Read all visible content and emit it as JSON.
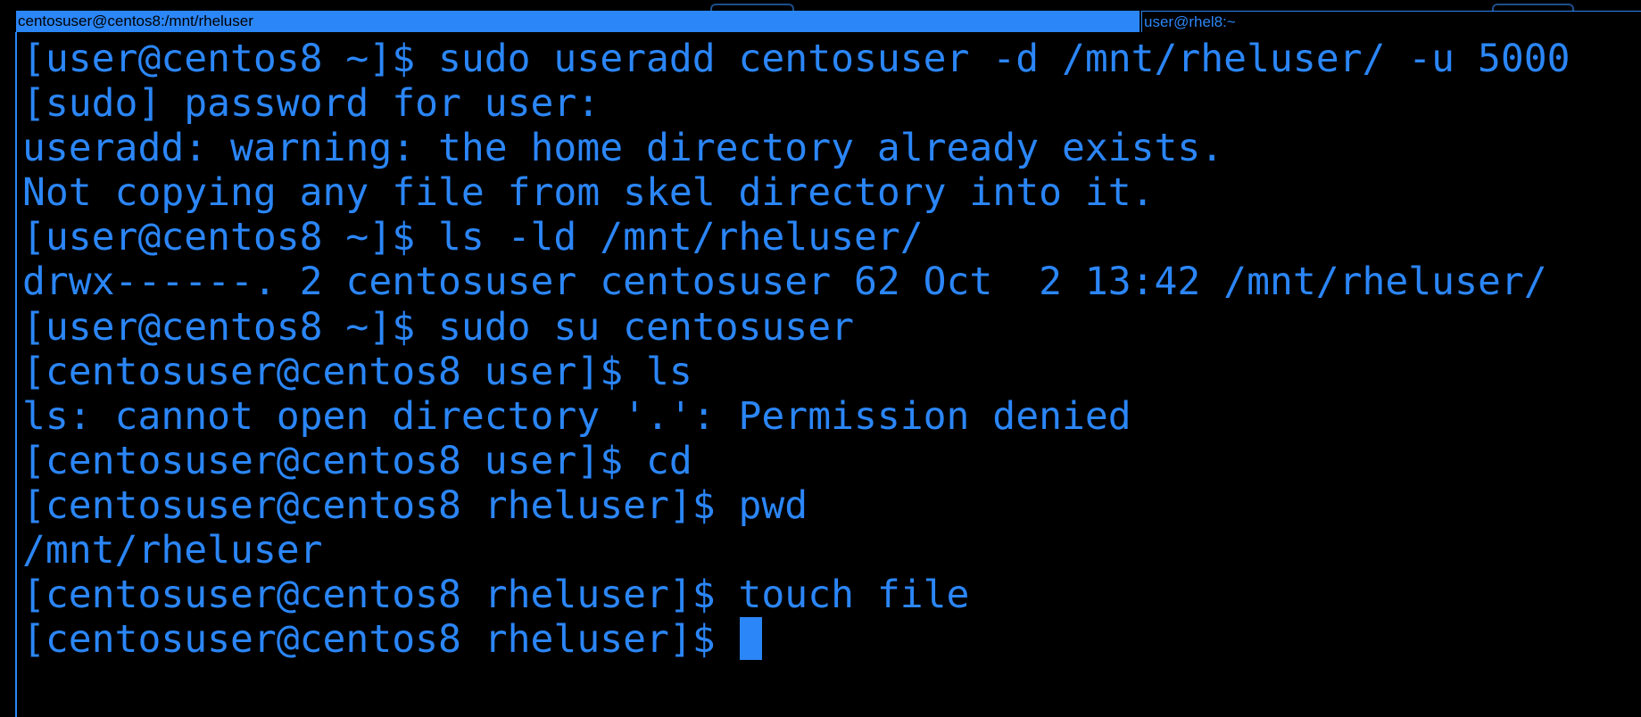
{
  "tabs": {
    "active_title": "centosuser@centos8:/mnt/rheluser",
    "inactive_title": "user@rhel8:~"
  },
  "terminal": {
    "lines": [
      "[user@centos8 ~]$ sudo useradd centosuser -d /mnt/rheluser/ -u 5000",
      "[sudo] password for user:",
      "useradd: warning: the home directory already exists.",
      "Not copying any file from skel directory into it.",
      "[user@centos8 ~]$ ls -ld /mnt/rheluser/",
      "drwx------. 2 centosuser centosuser 62 Oct  2 13:42 /mnt/rheluser/",
      "[user@centos8 ~]$ sudo su centosuser",
      "[centosuser@centos8 user]$ ls",
      "ls: cannot open directory '.': Permission denied",
      "[centosuser@centos8 user]$ cd",
      "[centosuser@centos8 rheluser]$ pwd",
      "/mnt/rheluser",
      "[centosuser@centos8 rheluser]$ touch file"
    ],
    "prompt": "[centosuser@centos8 rheluser]$ "
  },
  "colors": {
    "foreground": "#2b86f7",
    "background": "#000000",
    "accent": "#2b86f7"
  },
  "icons": {
    "cursor": "block-cursor"
  }
}
